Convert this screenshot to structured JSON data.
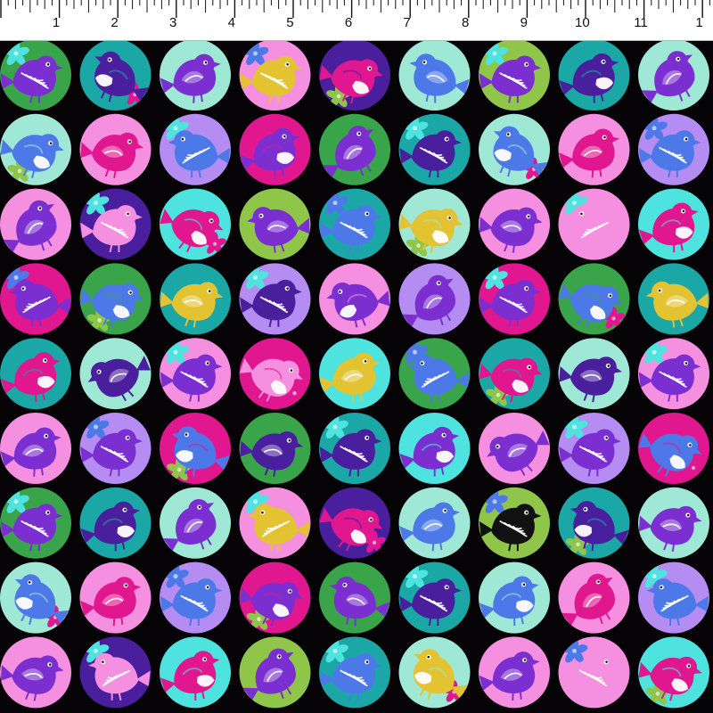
{
  "ruler": {
    "labels": [
      "1",
      "2",
      "3",
      "4",
      "5",
      "6",
      "7",
      "8",
      "9",
      "10",
      "11",
      "1"
    ]
  },
  "fabric": {
    "background": "#050305",
    "rows": 9,
    "columns": 9,
    "palette": {
      "pink": "#f58fe0",
      "magenta": "#e0178f",
      "violet": "#7b2fd0",
      "indigo": "#4a1f9e",
      "lavender": "#b48cf2",
      "teal": "#1aa7a6",
      "aqua": "#4fe3df",
      "mint": "#9fe8d6",
      "green": "#39a44a",
      "lime": "#8fc64a",
      "yellow": "#e3c332",
      "blue": "#4d79e8",
      "white": "#ffffff"
    },
    "tiles": [
      [
        "green-violet",
        "teal-indigo",
        "mint-violet",
        "pink-yellow",
        "indigo-magenta",
        "mint-blue",
        "lime-violet",
        "teal-indigo",
        "mint-violet"
      ],
      [
        "mint-blue",
        "pink-magenta",
        "lavender-blue",
        "magenta-violet",
        "green-violet",
        "teal-indigo",
        "mint-blue",
        "pink-magenta",
        "lavender-blue"
      ],
      [
        "pink-violet",
        "indigo-pink",
        "aqua-magenta",
        "lime-violet",
        "teal-blue",
        "mint-yellow",
        "pink-violet",
        "pink-pink",
        "aqua-magenta"
      ],
      [
        "magenta-violet",
        "green-blue",
        "teal-yellow",
        "lavender-indigo",
        "pink-violet",
        "lavender-violet",
        "magenta-violet",
        "green-blue",
        "teal-yellow"
      ],
      [
        "teal-magenta",
        "mint-indigo",
        "pink-violet",
        "magenta-pink",
        "aqua-yellow",
        "green-blue",
        "teal-magenta",
        "mint-indigo",
        "pink-violet"
      ],
      [
        "pink-violet",
        "lavender-violet",
        "magenta-blue",
        "green-indigo",
        "teal-indigo",
        "aqua-violet",
        "pink-violet",
        "lavender-violet",
        "magenta-blue"
      ],
      [
        "green-violet",
        "teal-indigo",
        "mint-violet",
        "pink-yellow",
        "indigo-magenta",
        "mint-blue",
        "lime-black",
        "teal-indigo",
        "mint-violet"
      ],
      [
        "mint-blue",
        "pink-magenta",
        "lavender-blue",
        "magenta-violet",
        "green-violet",
        "teal-indigo",
        "mint-blue",
        "pink-magenta",
        "lavender-blue"
      ],
      [
        "pink-violet",
        "indigo-pink",
        "aqua-magenta",
        "lime-violet",
        "teal-blue",
        "mint-yellow",
        "pink-violet",
        "pink-pink",
        "aqua-magenta"
      ]
    ]
  }
}
